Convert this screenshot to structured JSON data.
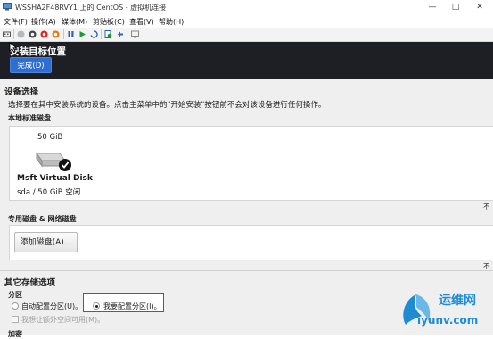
{
  "window": {
    "title": "WSSHA2F48RVY1 上的 CentOS - 虚拟机连接",
    "controls": [
      "—",
      "□",
      "✕"
    ]
  },
  "menubar": {
    "items": [
      "文件(F)",
      "操作(A)",
      "媒体(M)",
      "剪贴板(C)",
      "查看(V)",
      "帮助(H)"
    ]
  },
  "header": {
    "title": "安装目标位置",
    "done_label": "完成(D)"
  },
  "device_selection": {
    "title": "设备选择",
    "description": "选择要在其中安装系统的设备。点击主菜单中的\"开始安装\"按钮前不会对该设备进行任何操作。",
    "local_disks_label": "本地标准磁盘",
    "disk": {
      "size": "50 GiB",
      "name": "Msft Virtual Disk",
      "info": "sda  /  50 GiB 空闲",
      "selected": true
    },
    "right_cut_1": "不",
    "specialized_label": "专用磁盘 & 网络磁盘",
    "add_disk_label": "添加磁盘(A)...",
    "right_cut_2": "不"
  },
  "other_storage": {
    "title": "其它存储选项",
    "partition_label": "分区",
    "auto_partition": "自动配置分区(U)。",
    "manual_partition": "我要配置分区(I)。",
    "selected": "manual",
    "extra_space": "我想让额外空间可用(M)。",
    "encryption_label": "加密"
  },
  "watermark": {
    "cn": "运维网",
    "url": "iyunv.com"
  },
  "colors": {
    "header_bg": "#1d1f24",
    "done_button": "#2f6ed1",
    "highlight_box": "#d9272e",
    "watermark": "#1f8bd3"
  }
}
